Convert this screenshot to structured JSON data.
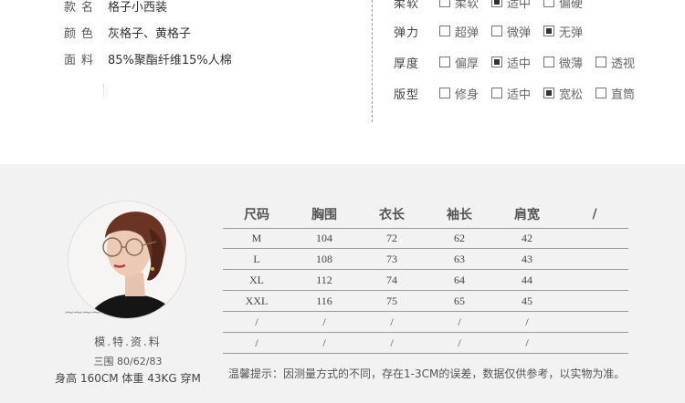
{
  "product_info": [
    {
      "key": "款名",
      "value": "格子小西装"
    },
    {
      "key": "颜色",
      "value": "灰格子、黄格子"
    },
    {
      "key": "面料",
      "value": "85%聚酯纤维15%人棉"
    }
  ],
  "attributes": [
    {
      "key": "柔软",
      "options": [
        {
          "label": "柔软",
          "checked": false
        },
        {
          "label": "适中",
          "checked": true
        },
        {
          "label": "偏硬",
          "checked": false
        }
      ]
    },
    {
      "key": "弹力",
      "options": [
        {
          "label": "超弹",
          "checked": false
        },
        {
          "label": "微弹",
          "checked": false
        },
        {
          "label": "无弹",
          "checked": true
        }
      ]
    },
    {
      "key": "厚度",
      "options": [
        {
          "label": "偏厚",
          "checked": false
        },
        {
          "label": "适中",
          "checked": true
        },
        {
          "label": "微薄",
          "checked": false
        },
        {
          "label": "透视",
          "checked": false
        }
      ]
    },
    {
      "key": "版型",
      "options": [
        {
          "label": "修身",
          "checked": false
        },
        {
          "label": "适中",
          "checked": false
        },
        {
          "label": "宽松",
          "checked": true
        },
        {
          "label": "直筒",
          "checked": false
        }
      ]
    }
  ],
  "model": {
    "title": "模.特.资.料",
    "bust": "三围 80/62/83",
    "body": "身高 160CM 体重 43KG 穿M"
  },
  "size_table": {
    "headers": [
      "尺码",
      "胸围",
      "衣长",
      "袖长",
      "肩宽",
      "/"
    ],
    "rows": [
      [
        "M",
        "104",
        "72",
        "62",
        "42",
        ""
      ],
      [
        "L",
        "108",
        "73",
        "63",
        "43",
        ""
      ],
      [
        "XL",
        "112",
        "74",
        "64",
        "44",
        ""
      ],
      [
        "XXL",
        "116",
        "75",
        "65",
        "45",
        ""
      ],
      [
        "/",
        "/",
        "/",
        "/",
        "/",
        ""
      ],
      [
        "/",
        "/",
        "/",
        "/",
        "/",
        ""
      ]
    ]
  },
  "tip": "温馨提示：因测量方式的不同，存在1-3CM的误差，数据仅供参考，以实物为准。",
  "colors": {
    "section_bg": "#f2f2f2",
    "text": "#444444",
    "rule": "#9a9a9a"
  }
}
